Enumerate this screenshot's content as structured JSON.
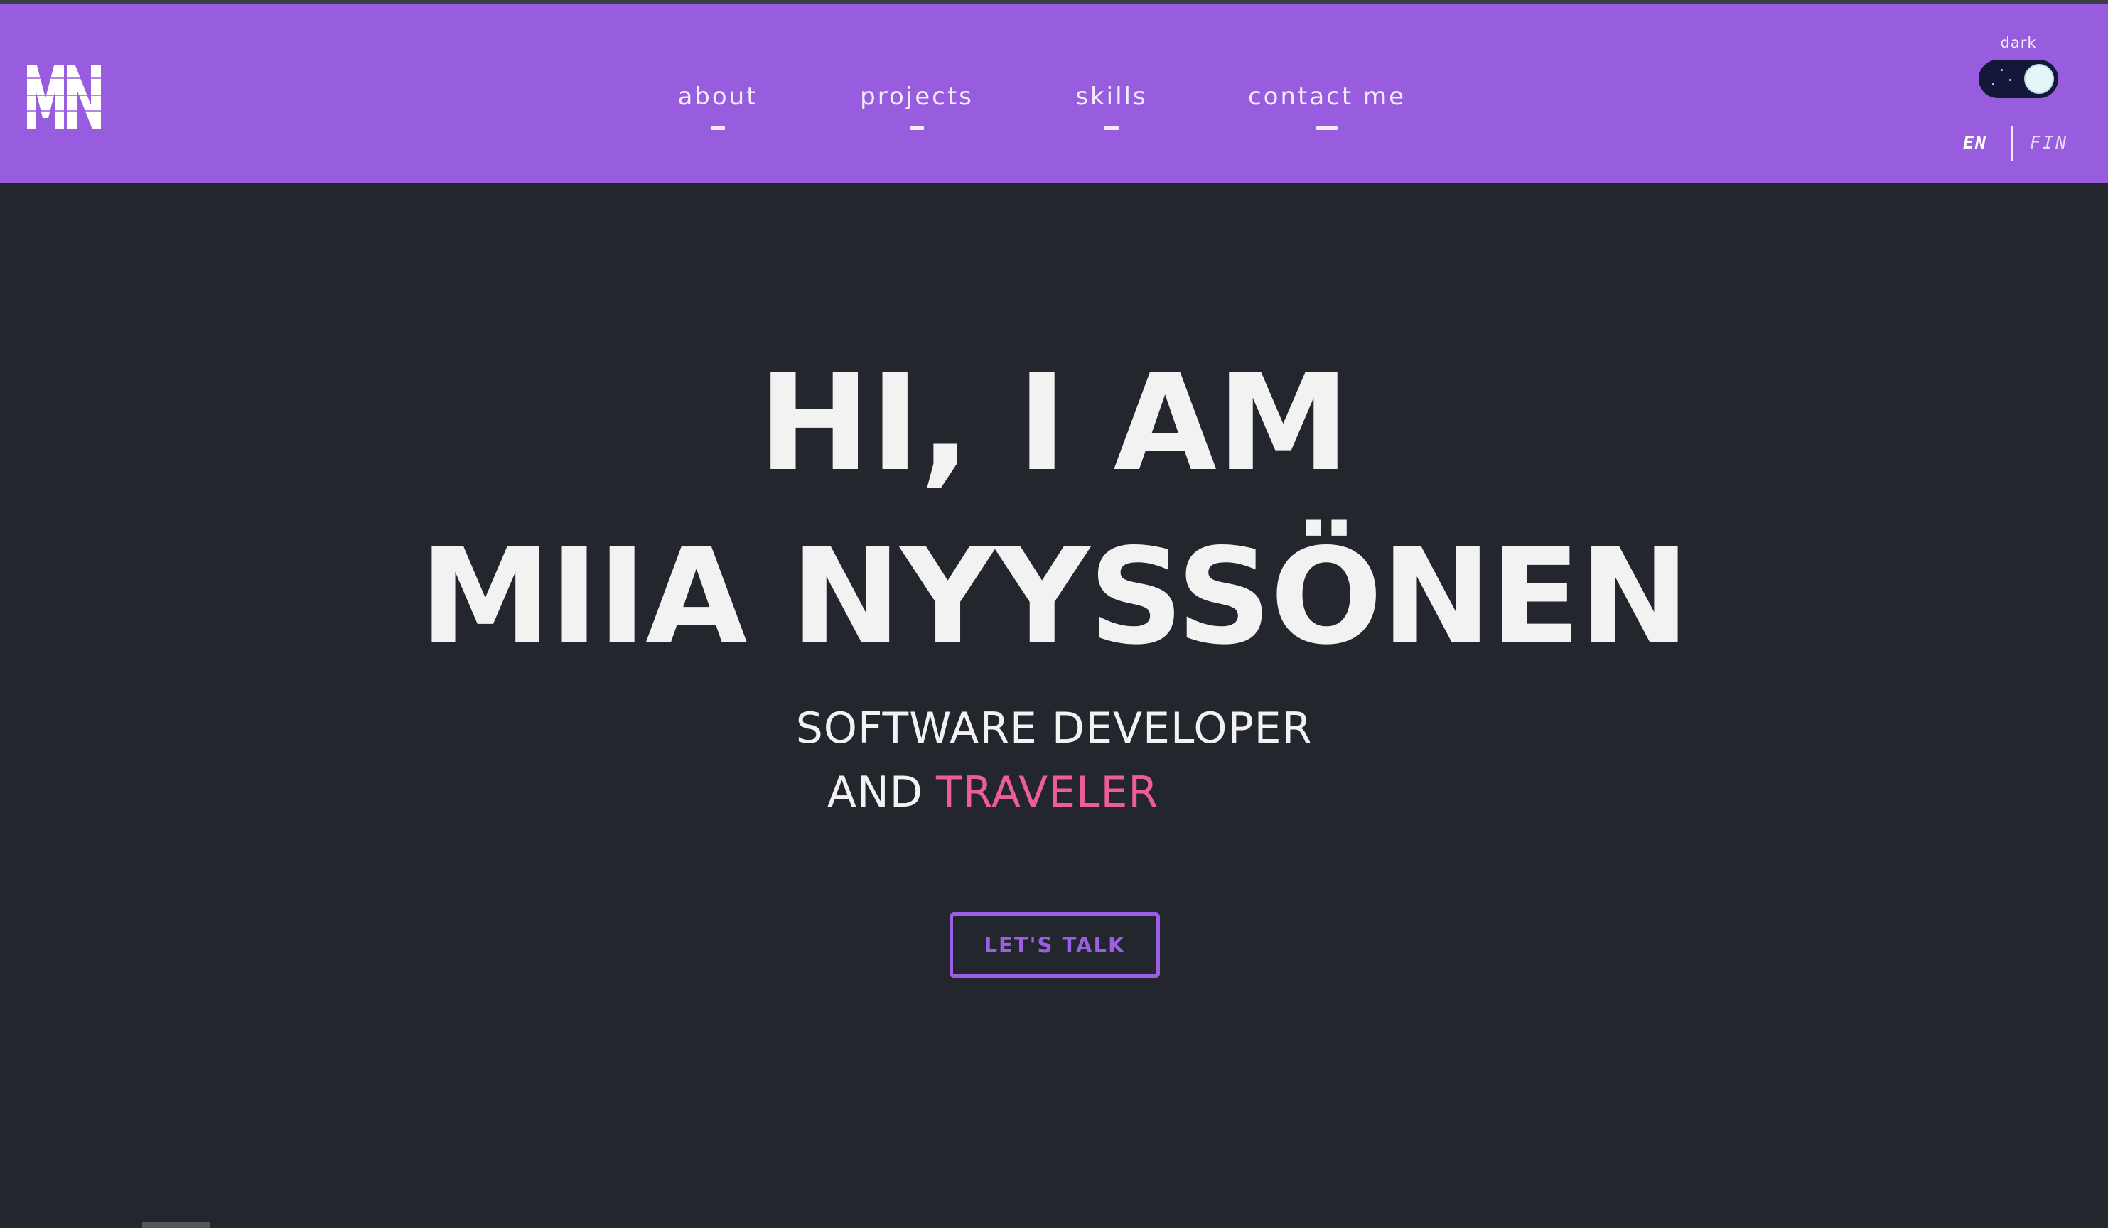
{
  "colors": {
    "navbar": "#985ddf",
    "background": "#23262d",
    "accent_pink": "#ee5e96",
    "accent_purple": "#9a5fe4",
    "text": "#f2f2f2"
  },
  "logo": {
    "text": "MN",
    "icon": "mn-monogram-logo"
  },
  "nav": {
    "items": [
      {
        "label": "about"
      },
      {
        "label": "projects"
      },
      {
        "label": "skills"
      },
      {
        "label": "contact me"
      }
    ]
  },
  "theme": {
    "label": "dark",
    "mode": "dark",
    "toggle_icon": "moon-toggle-icon"
  },
  "language": {
    "options": [
      "EN",
      "FIN"
    ],
    "selected": "EN"
  },
  "hero": {
    "line1": "HI, I AM",
    "line2": "MIIA NYYSSÖNEN",
    "subtitle_line1": "SOFTWARE DEVELOPER",
    "subtitle_line2_prefix": "AND",
    "subtitle_line2_accent": "TRAVELER",
    "cta_label": "LET'S TALK"
  }
}
